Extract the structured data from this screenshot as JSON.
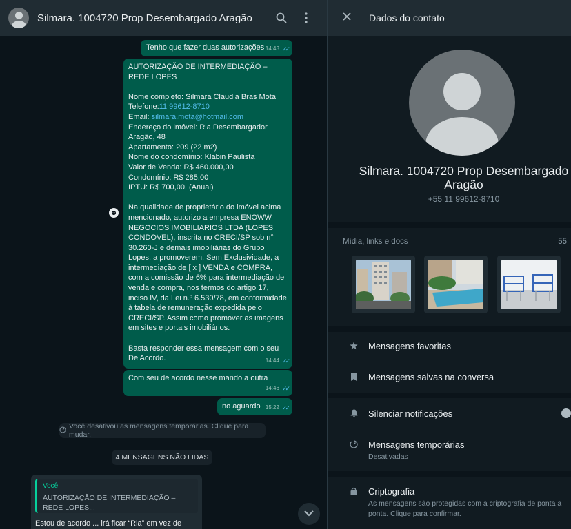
{
  "chat": {
    "title": "Silmara. 1004720 Prop Desembargado Aragão",
    "messages": [
      {
        "text": "Tenho que fazer duas autorizações",
        "time": "14:43"
      },
      {
        "lines": [
          "AUTORIZAÇÃO DE INTERMEDIAÇÃO – REDE LOPES",
          "",
          "Nome completo: Silmara Claudia Bras Mota"
        ],
        "phone_label": "Telefone:",
        "phone": "11 99612-8710",
        "email_label": "Email: ",
        "email": "silmara.mota@hotmail.com",
        "lines2": "Endereço do imóvel: Ria Desembargador Aragão, 48\nApartamento: 209 (22 m2)\nNome do condomínio: Klabin Paulista\nValor de Venda: R$ 460.000,00\nCondomínio: R$ 285,00\nIPTU: R$ 700,00. (Anual)\n\nNa qualidade de proprietário do imóvel acima mencionado, autorizo a empresa ENOWW NEGOCIOS IMOBILIARIOS LTDA (LOPES CONDOVEL), inscrita no CRECI/SP sob n° 30.260-J e demais imobiliárias do Grupo Lopes, a promoverem, Sem Exclusividade, a intermediação de [ x ] VENDA e COMPRA, com a comissão de 6% para intermediação de venda e compra, nos termos do artigo 17, inciso IV, da Lei n.º 6.530/78, em conformidade à tabela de remuneração expedida pelo CRECI/SP. Assim como promover as imagens em sites e portais imobiliários.\n\nBasta responder essa mensagem com o seu De Acordo.",
        "time": "14:44"
      },
      {
        "text": "Com seu de acordo nesse mando a outra",
        "time": "14:46"
      },
      {
        "text": "no aguardo",
        "time": "15:22"
      }
    ],
    "system_temp": "Você desativou as mensagens temporárias. Clique para mudar.",
    "unread": "4 MENSAGENS NÃO LIDAS",
    "incoming": {
      "quote_author": "Você",
      "quote_text": "AUTORIZAÇÃO DE INTERMEDIAÇÃO – REDE LOPES...",
      "text": "Estou de acordo ... irá ficar “Ria” em vez de Rua?"
    }
  },
  "info": {
    "title": "Dados do contato",
    "name": "Silmara. 1004720 Prop Desembargado Aragão",
    "phone": "+55 11 99612-8710",
    "media_label": "Mídia, links e docs",
    "media_count": "55",
    "rows": {
      "favorites": "Mensagens favoritas",
      "saved": "Mensagens salvas na conversa",
      "mute": "Silenciar notificações",
      "temporary": "Mensagens temporárias",
      "temporary_sub": "Desativadas",
      "crypto": "Criptografia",
      "crypto_sub": "As mensagens são protegidas com a criptografia de ponta a ponta. Clique para confirmar."
    }
  },
  "colors": {
    "outgoing": "#005c4b",
    "incoming": "#202c33",
    "accent": "#06cf9c",
    "link": "#53bdeb"
  },
  "icons": [
    "search-icon",
    "menu-icon",
    "close-icon",
    "star-icon",
    "bookmark-icon",
    "bell-icon",
    "timer-icon",
    "lock-icon",
    "chevron-down-icon",
    "emoji-icon"
  ]
}
